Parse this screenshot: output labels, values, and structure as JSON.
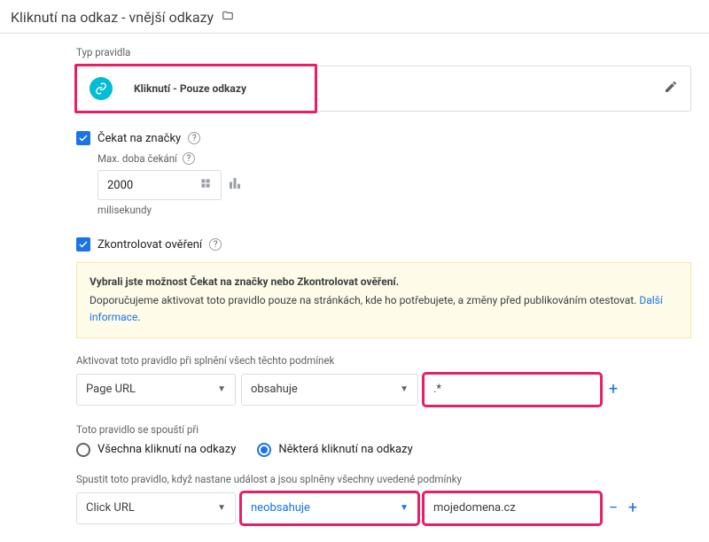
{
  "header": {
    "title": "Kliknutí na odkaz - vnější odkazy"
  },
  "type_section": {
    "label": "Typ pravidla",
    "trigger_name": "Kliknutí - Pouze odkazy"
  },
  "wait": {
    "label": "Čekat na značky",
    "max_label": "Max. doba čekání",
    "value": "2000",
    "unit": "milisekundy"
  },
  "validation": {
    "label": "Zkontrolovat ověření"
  },
  "info": {
    "bold": "Vybrali jste možnost Čekat na značky nebo Zkontrolovat ověření.",
    "text": "Doporučujeme aktivovat toto pravidlo pouze na stránkách, kde ho potřebujete, a změny před publikováním otestovat. ",
    "link": "Další informace"
  },
  "activate": {
    "label": "Aktivovat toto pravidlo při splnění všech těchto podmínek",
    "var": "Page URL",
    "op": "obsahuje",
    "val": ".*"
  },
  "fireon": {
    "label": "Toto pravidlo se spouští při",
    "opt1": "Všechna kliknutí na odkazy",
    "opt2": "Některá kliknutí na odkazy"
  },
  "fire_cond": {
    "label": "Spustit toto pravidlo, když nastane událost a jsou splněny všechny uvedené podmínky",
    "var": "Click URL",
    "op": "neobsahuje",
    "val": "mojedomena.cz"
  },
  "glyphs": {
    "plus": "+",
    "minus": "−",
    "caret": "▼",
    "help": "?"
  }
}
